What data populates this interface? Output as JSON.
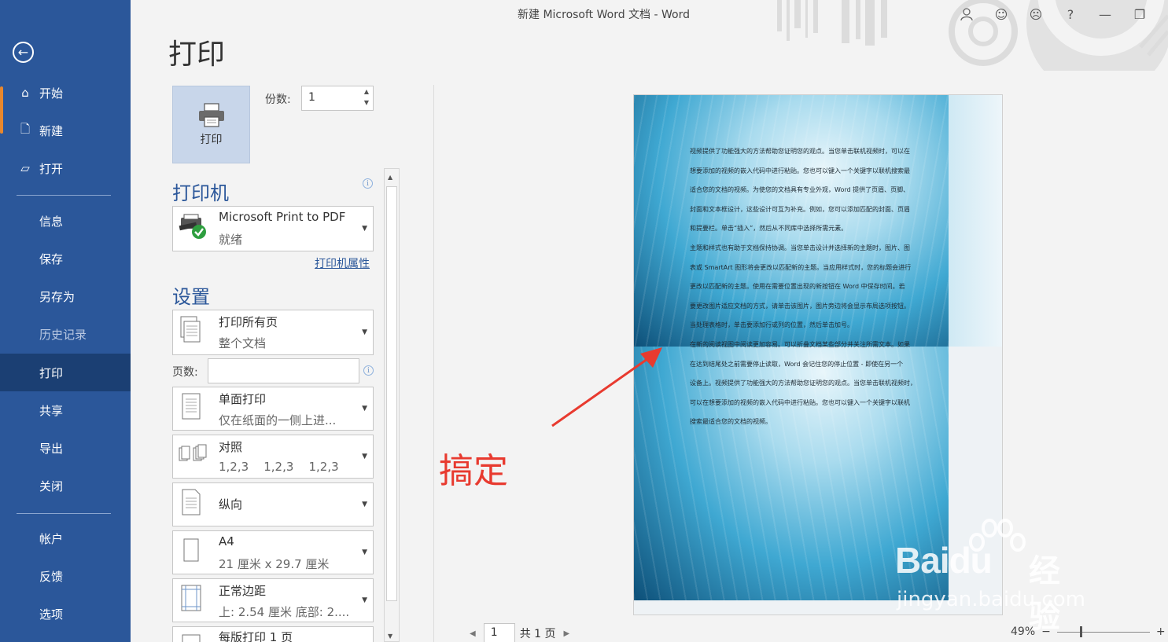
{
  "window": {
    "title": "新建 Microsoft Word 文档  -  Word"
  },
  "sidebar": {
    "items": [
      {
        "label": "开始",
        "icon": "home-icon"
      },
      {
        "label": "新建",
        "icon": "new-doc-icon"
      },
      {
        "label": "打开",
        "icon": "folder-open-icon"
      },
      {
        "label": "信息"
      },
      {
        "label": "保存"
      },
      {
        "label": "另存为"
      },
      {
        "label": "历史记录",
        "disabled": true
      },
      {
        "label": "打印",
        "active": true
      },
      {
        "label": "共享"
      },
      {
        "label": "导出"
      },
      {
        "label": "关闭"
      },
      {
        "label": "帐户"
      },
      {
        "label": "反馈"
      },
      {
        "label": "选项"
      }
    ]
  },
  "print": {
    "page_title": "打印",
    "print_button_label": "打印",
    "copies_label": "份数:",
    "copies_value": "1",
    "printer_section": "打印机",
    "printer_name": "Microsoft Print to PDF",
    "printer_status": "就绪",
    "printer_properties": "打印机属性",
    "settings_section": "设置",
    "pages_label": "页数:",
    "pages_value": "",
    "settings": [
      {
        "line1": "打印所有页",
        "line2": "整个文档"
      },
      {
        "line1": "单面打印",
        "line2": "仅在纸面的一侧上进..."
      },
      {
        "line1": "对照",
        "line2": "1,2,3    1,2,3    1,2,3"
      },
      {
        "line1": "纵向",
        "line2": ""
      },
      {
        "line1": "A4",
        "line2": "21 厘米 x 29.7 厘米"
      },
      {
        "line1": "正常边距",
        "line2": "上: 2.54 厘米 底部: 2...."
      },
      {
        "line1": "每版打印 1 页",
        "line2": ""
      }
    ]
  },
  "preview": {
    "lines": [
      "视频提供了功能强大的方法帮助您证明您的观点。当您单击联机视频时，可以在",
      "想要添加的视频的嵌入代码中进行粘贴。您也可以键入一个关键字以联机搜索最",
      "适合您的文档的视频。为使您的文档具有专业外观，Word 提供了页眉、页脚、",
      "封面和文本框设计，这些设计可互为补充。例如，您可以添加匹配的封面、页眉",
      "和提要栏。单击“插入”，然后从不同库中选择所需元素。",
      "主题和样式也有助于文档保持协调。当您单击设计并选择新的主题时，图片、图",
      "表或 SmartArt 图形将会更改以匹配新的主题。当应用样式时，您的标题会进行",
      "更改以匹配新的主题。使用在需要位置出现的新按钮在 Word 中保存时间。若",
      "要更改图片适应文档的方式，请单击该图片，图片旁边将会显示布局选项按钮。",
      "当处理表格时，单击要添加行或列的位置，然后单击加号。",
      "在新的阅读视图中阅读更加容易。可以折叠文档某些部分并关注所需文本。如果",
      "在达到结尾处之前需要停止读取，Word 会记住您的停止位置 - 即使在另一个",
      "设备上。视频提供了功能强大的方法帮助您证明您的观点。当您单击联机视频时，",
      "可以在想要添加的视频的嵌入代码中进行粘贴。您也可以键入一个关键字以联机",
      "搜索最适合您的文档的视频。"
    ],
    "annotation": "搞定",
    "watermark_brand": "Baidu",
    "watermark_cn": "经验",
    "watermark_url": "jingyan.baidu.com"
  },
  "nav": {
    "page_value": "1",
    "total_pages": "共 1 页",
    "zoom": "49%",
    "zoom_minus": "−",
    "zoom_plus": "+"
  },
  "colors": {
    "sidebar": "#2b579a",
    "active": "#1b3f73",
    "accent": "#2b579a",
    "annotation": "#e83a2f"
  }
}
